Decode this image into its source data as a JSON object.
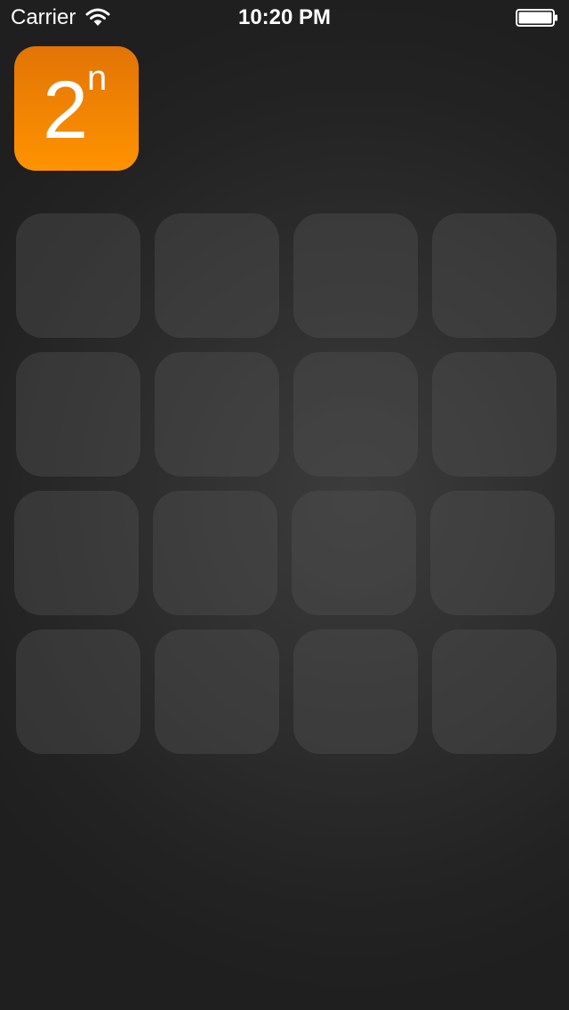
{
  "status_bar": {
    "carrier": "Carrier",
    "time": "10:20 PM",
    "wifi_icon": "wifi-icon",
    "battery_icon": "battery-full-icon"
  },
  "logo": {
    "base": "2",
    "exponent": "n",
    "color_top": "#e27406",
    "color_bottom": "#ff9300"
  },
  "board": {
    "rows": 4,
    "columns": 4,
    "tiles": [
      [
        "",
        "",
        "",
        ""
      ],
      [
        "",
        "",
        "",
        ""
      ],
      [
        "",
        "",
        "",
        ""
      ],
      [
        "",
        "",
        "",
        ""
      ]
    ]
  }
}
